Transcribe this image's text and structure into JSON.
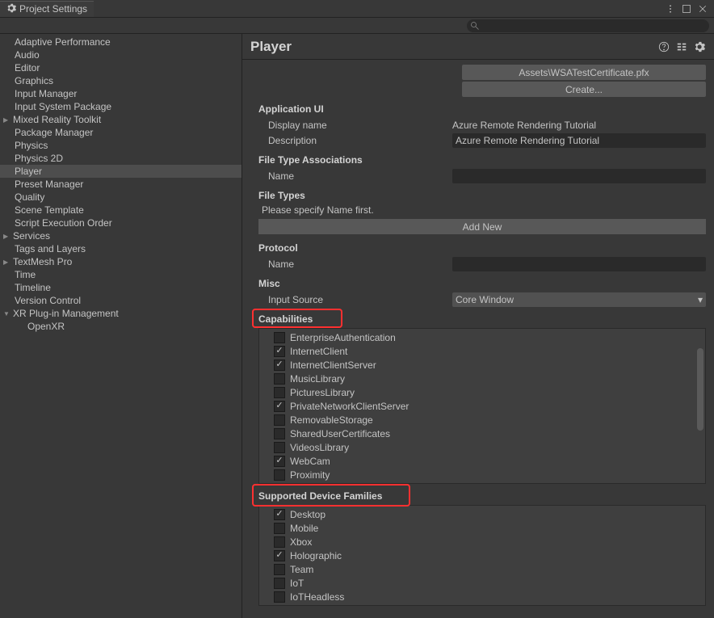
{
  "window": {
    "title": "Project Settings"
  },
  "sidebar": {
    "items": [
      {
        "label": "Adaptive Performance",
        "type": "item"
      },
      {
        "label": "Audio",
        "type": "item"
      },
      {
        "label": "Editor",
        "type": "item"
      },
      {
        "label": "Graphics",
        "type": "item"
      },
      {
        "label": "Input Manager",
        "type": "item"
      },
      {
        "label": "Input System Package",
        "type": "item"
      },
      {
        "label": "Mixed Reality Toolkit",
        "type": "expandable",
        "expanded": false
      },
      {
        "label": "Package Manager",
        "type": "item"
      },
      {
        "label": "Physics",
        "type": "item"
      },
      {
        "label": "Physics 2D",
        "type": "item"
      },
      {
        "label": "Player",
        "type": "item",
        "selected": true
      },
      {
        "label": "Preset Manager",
        "type": "item"
      },
      {
        "label": "Quality",
        "type": "item"
      },
      {
        "label": "Scene Template",
        "type": "item"
      },
      {
        "label": "Script Execution Order",
        "type": "item"
      },
      {
        "label": "Services",
        "type": "expandable",
        "expanded": false
      },
      {
        "label": "Tags and Layers",
        "type": "item"
      },
      {
        "label": "TextMesh Pro",
        "type": "expandable",
        "expanded": false
      },
      {
        "label": "Time",
        "type": "item"
      },
      {
        "label": "Timeline",
        "type": "item"
      },
      {
        "label": "Version Control",
        "type": "item"
      },
      {
        "label": "XR Plug-in Management",
        "type": "expandable",
        "expanded": true
      },
      {
        "label": "OpenXR",
        "type": "child"
      }
    ]
  },
  "content": {
    "title": "Player",
    "cert_path": "Assets\\WSATestCertificate.pfx",
    "create_btn": "Create...",
    "app_ui_section": "Application UI",
    "display_name_label": "Display name",
    "display_name_value": "Azure Remote Rendering Tutorial",
    "description_label": "Description",
    "description_value": "Azure Remote Rendering Tutorial",
    "file_type_assoc_section": "File Type Associations",
    "name_label": "Name",
    "file_types_section": "File Types",
    "file_types_msg": "Please specify Name first.",
    "add_new_btn": "Add New",
    "protocol_section": "Protocol",
    "misc_section": "Misc",
    "input_source_label": "Input Source",
    "input_source_value": "Core Window",
    "capabilities_section": "Capabilities",
    "capabilities": [
      {
        "label": "EnterpriseAuthentication",
        "checked": false
      },
      {
        "label": "InternetClient",
        "checked": true
      },
      {
        "label": "InternetClientServer",
        "checked": true
      },
      {
        "label": "MusicLibrary",
        "checked": false
      },
      {
        "label": "PicturesLibrary",
        "checked": false
      },
      {
        "label": "PrivateNetworkClientServer",
        "checked": true
      },
      {
        "label": "RemovableStorage",
        "checked": false
      },
      {
        "label": "SharedUserCertificates",
        "checked": false
      },
      {
        "label": "VideosLibrary",
        "checked": false
      },
      {
        "label": "WebCam",
        "checked": true
      },
      {
        "label": "Proximity",
        "checked": false
      }
    ],
    "device_families_section": "Supported Device Families",
    "device_families": [
      {
        "label": "Desktop",
        "checked": true
      },
      {
        "label": "Mobile",
        "checked": false
      },
      {
        "label": "Xbox",
        "checked": false
      },
      {
        "label": "Holographic",
        "checked": true
      },
      {
        "label": "Team",
        "checked": false
      },
      {
        "label": "IoT",
        "checked": false
      },
      {
        "label": "IoTHeadless",
        "checked": false
      }
    ]
  }
}
